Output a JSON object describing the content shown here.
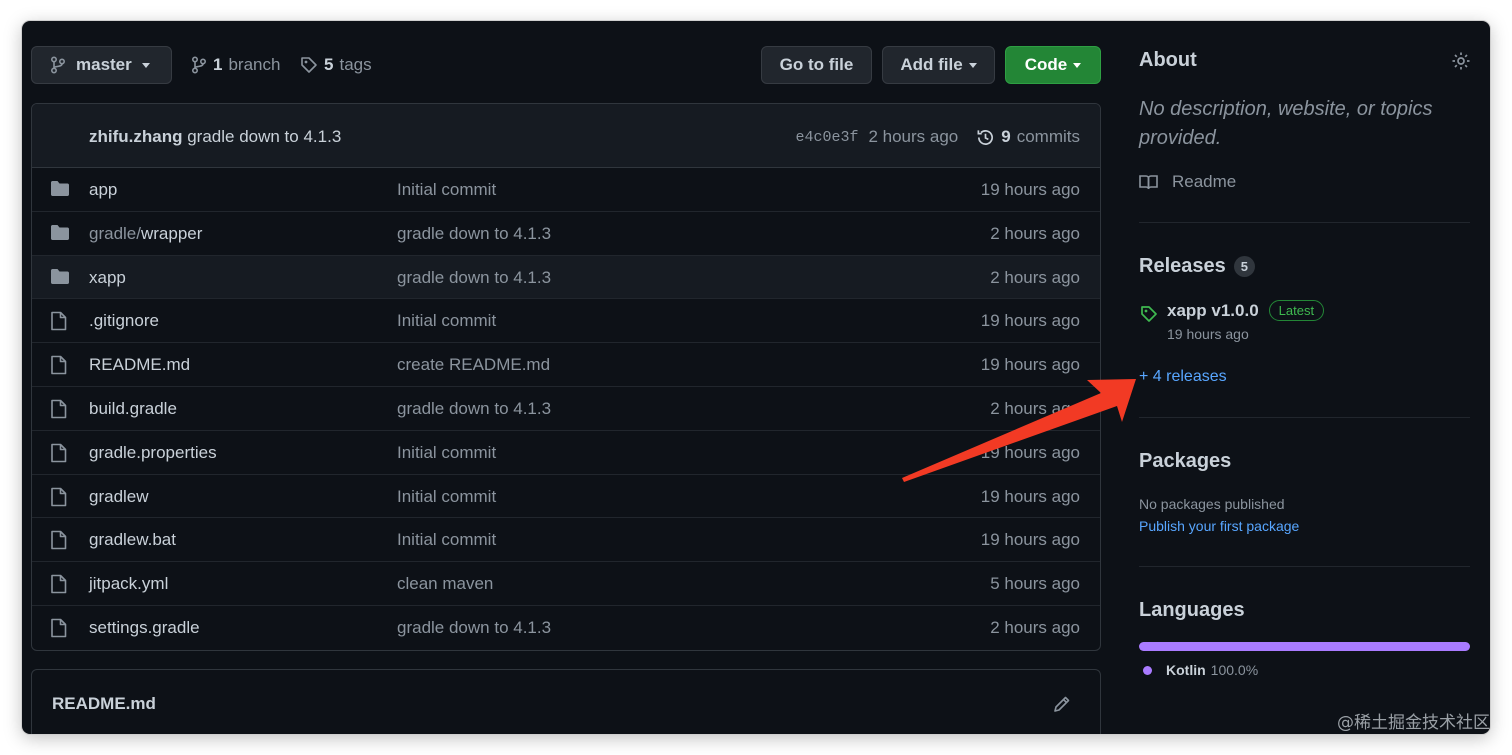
{
  "toolbar": {
    "branch_selector": "master",
    "branch_count": "1",
    "branch_label": "branch",
    "tag_count": "5",
    "tag_label": "tags",
    "go_to_file": "Go to file",
    "add_file": "Add file",
    "code": "Code"
  },
  "commit": {
    "author": "zhifu.zhang",
    "message": "gradle down to 4.1.3",
    "sha": "e4c0e3f",
    "age": "2 hours ago",
    "count": "9",
    "count_label": "commits"
  },
  "files": [
    {
      "type": "dir",
      "name": "app",
      "message": "Initial commit",
      "age": "19 hours ago"
    },
    {
      "type": "dir",
      "name_prefix": "gradle/",
      "name": "wrapper",
      "message": "gradle down to 4.1.3",
      "age": "2 hours ago"
    },
    {
      "type": "dir",
      "name": "xapp",
      "message": "gradle down to 4.1.3",
      "age": "2 hours ago"
    },
    {
      "type": "file",
      "name": ".gitignore",
      "message": "Initial commit",
      "age": "19 hours ago"
    },
    {
      "type": "file",
      "name": "README.md",
      "message": "create README.md",
      "age": "19 hours ago"
    },
    {
      "type": "file",
      "name": "build.gradle",
      "message": "gradle down to 4.1.3",
      "age": "2 hours ago"
    },
    {
      "type": "file",
      "name": "gradle.properties",
      "message": "Initial commit",
      "age": "19 hours ago"
    },
    {
      "type": "file",
      "name": "gradlew",
      "message": "Initial commit",
      "age": "19 hours ago"
    },
    {
      "type": "file",
      "name": "gradlew.bat",
      "message": "Initial commit",
      "age": "19 hours ago"
    },
    {
      "type": "file",
      "name": "jitpack.yml",
      "message": "clean maven",
      "age": "5 hours ago"
    },
    {
      "type": "file",
      "name": "settings.gradle",
      "message": "gradle down to 4.1.3",
      "age": "2 hours ago"
    }
  ],
  "readme": {
    "title": "README.md"
  },
  "about": {
    "heading": "About",
    "description_line1": "No description, website, or topics",
    "description_line2": "provided.",
    "readme_link": "Readme"
  },
  "releases": {
    "heading": "Releases",
    "count": "5",
    "latest_name": "xapp v1.0.0",
    "latest_badge": "Latest",
    "latest_age": "19 hours ago",
    "more_link": "+ 4 releases"
  },
  "packages": {
    "heading": "Packages",
    "none_text": "No packages published",
    "publish_link": "Publish your first package"
  },
  "languages": {
    "heading": "Languages",
    "items": [
      {
        "name": "Kotlin",
        "percent": "100.0%",
        "fraction": 1.0,
        "color": "#a97bff"
      }
    ]
  },
  "colors": {
    "background": "#0d1117",
    "accent_green": "#238636",
    "link_blue": "#58a6ff",
    "annotation_arrow": "#f23a24"
  },
  "watermark": "@稀土掘金技术社区"
}
